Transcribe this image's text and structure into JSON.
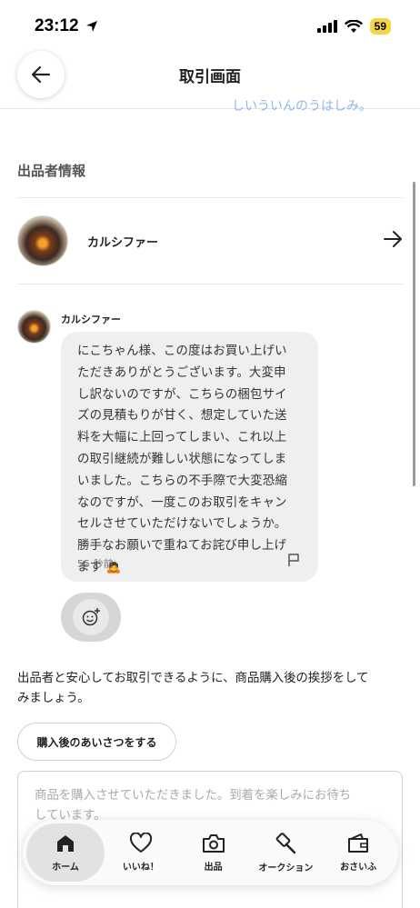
{
  "status_bar": {
    "time": "23:12",
    "battery": "59"
  },
  "header": {
    "title": "取引画面"
  },
  "cut_link": "しいういんのうはしみ。",
  "seller_section": {
    "title": "出品者情報",
    "name": "カルシファー"
  },
  "message": {
    "sender": "カルシファー",
    "lines": [
      "にこちゃん様、この度はお買い上げい",
      "ただきありがとうございます。大変申",
      "し訳ないのですが、こちらの梱包サイ",
      "ズの見積もりが甘く、想定していた送",
      "料を大幅に上回ってしまい、これ以上",
      "の取引継続が難しい状態になってしま",
      "いました。こちらの不手際で大変恐縮",
      "なのですが、一度このお取引をキャン",
      "セルさせていただけないでしょうか。",
      "勝手なお願いで重ねてお詫び申し上げ",
      "ます 🙇"
    ],
    "time": "55 秒前"
  },
  "guide": {
    "line1": "出品者と安心してお取引できるように、商品購入後の挨拶をして",
    "line2": "みましょう。"
  },
  "greet_button": "購入後のあいさつをする",
  "textarea": {
    "line1": "商品を購入させていただきました。到着を楽しみにお待ち",
    "line2": "しています。"
  },
  "nav": {
    "home": "ホーム",
    "likes": "いいね！",
    "sell": "出品",
    "auction": "オークション",
    "wallet": "おさいふ"
  },
  "colors": {
    "accent": "#4a90d9",
    "bubble": "#efefef"
  }
}
